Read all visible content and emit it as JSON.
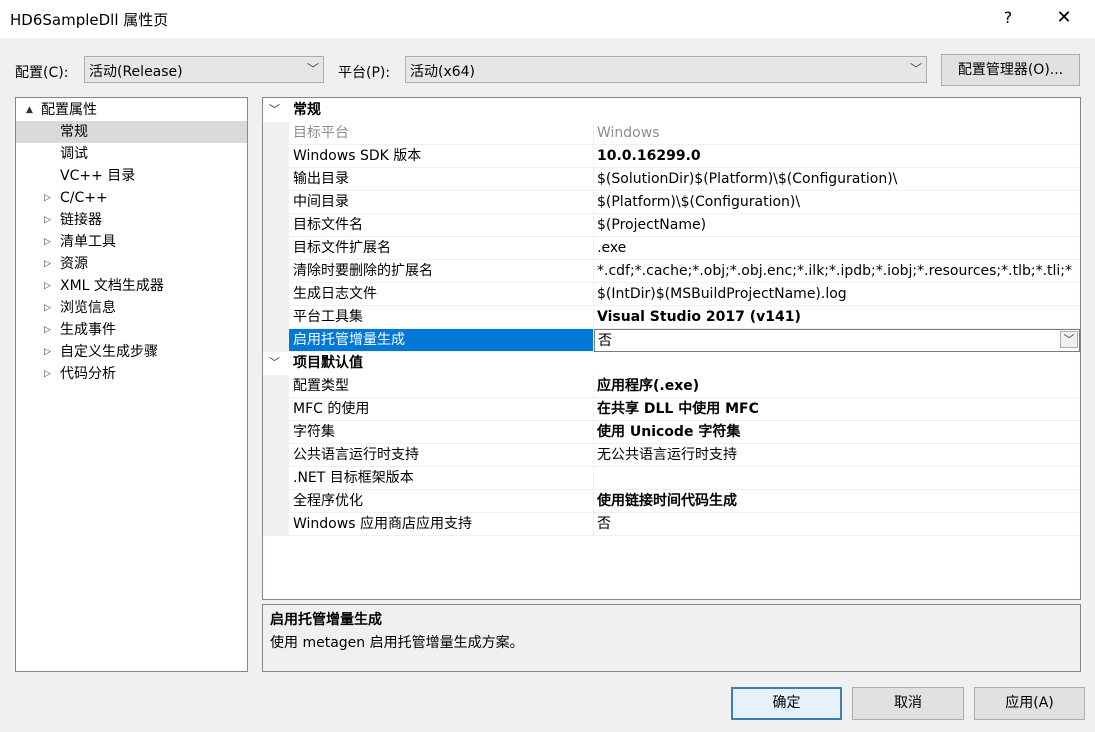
{
  "window": {
    "title": "HD6SampleDll 属性页",
    "help": "?",
    "close": "✕"
  },
  "toolbar": {
    "config_label": "配置(C):",
    "config_value": "活动(Release)",
    "platform_label": "平台(P):",
    "platform_value": "活动(x64)",
    "config_manager": "配置管理器(O)..."
  },
  "tree": [
    {
      "label": "配置属性",
      "indent": 0,
      "expander": "▲"
    },
    {
      "label": "常规",
      "indent": 1,
      "expander": "",
      "selected": true
    },
    {
      "label": "调试",
      "indent": 1,
      "expander": ""
    },
    {
      "label": "VC++ 目录",
      "indent": 1,
      "expander": ""
    },
    {
      "label": "C/C++",
      "indent": 1,
      "expander": "▷"
    },
    {
      "label": "链接器",
      "indent": 1,
      "expander": "▷"
    },
    {
      "label": "清单工具",
      "indent": 1,
      "expander": "▷"
    },
    {
      "label": "资源",
      "indent": 1,
      "expander": "▷"
    },
    {
      "label": "XML 文档生成器",
      "indent": 1,
      "expander": "▷"
    },
    {
      "label": "浏览信息",
      "indent": 1,
      "expander": "▷"
    },
    {
      "label": "生成事件",
      "indent": 1,
      "expander": "▷"
    },
    {
      "label": "自定义生成步骤",
      "indent": 1,
      "expander": "▷"
    },
    {
      "label": "代码分析",
      "indent": 1,
      "expander": "▷"
    }
  ],
  "grid": {
    "categories": [
      {
        "title": "常规",
        "rows": [
          {
            "name": "目标平台",
            "value": "Windows",
            "disabled": true
          },
          {
            "name": "Windows SDK 版本",
            "value": "10.0.16299.0",
            "bold": true
          },
          {
            "name": "输出目录",
            "value": "$(SolutionDir)$(Platform)\\$(Configuration)\\"
          },
          {
            "name": "中间目录",
            "value": "$(Platform)\\$(Configuration)\\"
          },
          {
            "name": "目标文件名",
            "value": "$(ProjectName)"
          },
          {
            "name": "目标文件扩展名",
            "value": ".exe"
          },
          {
            "name": "清除时要删除的扩展名",
            "value": "*.cdf;*.cache;*.obj;*.obj.enc;*.ilk;*.ipdb;*.iobj;*.resources;*.tlb;*.tli;*"
          },
          {
            "name": "生成日志文件",
            "value": "$(IntDir)$(MSBuildProjectName).log"
          },
          {
            "name": "平台工具集",
            "value": "Visual Studio 2017 (v141)",
            "bold": true
          },
          {
            "name": "启用托管增量生成",
            "value": "否",
            "selected": true
          }
        ]
      },
      {
        "title": "项目默认值",
        "rows": [
          {
            "name": "配置类型",
            "value": "应用程序(.exe)",
            "bold": true
          },
          {
            "name": "MFC 的使用",
            "value": "在共享 DLL 中使用 MFC",
            "bold": true
          },
          {
            "name": "字符集",
            "value": "使用 Unicode 字符集",
            "bold": true
          },
          {
            "name": "公共语言运行时支持",
            "value": "无公共语言运行时支持"
          },
          {
            "name": ".NET 目标框架版本",
            "value": ""
          },
          {
            "name": "全程序优化",
            "value": "使用链接时间代码生成",
            "bold": true
          },
          {
            "name": "Windows 应用商店应用支持",
            "value": "否"
          }
        ]
      }
    ]
  },
  "description": {
    "title": "启用托管增量生成",
    "text": "使用 metagen 启用托管增量生成方案。"
  },
  "buttons": {
    "ok": "确定",
    "cancel": "取消",
    "apply": "应用(A)"
  }
}
